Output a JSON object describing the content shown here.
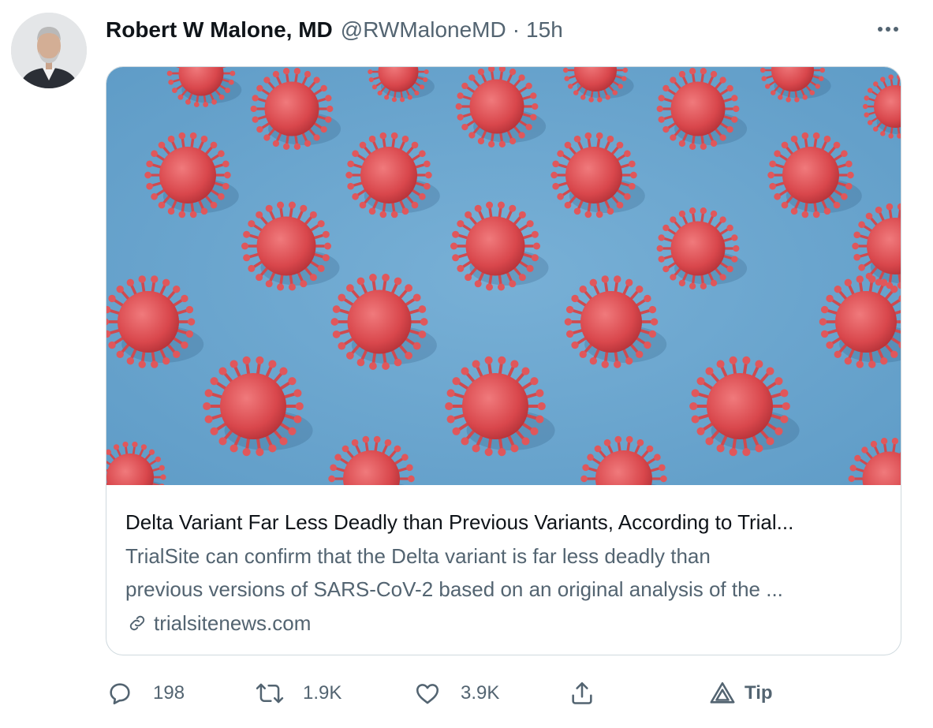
{
  "tweet": {
    "author_name": "Robert W Malone, MD",
    "handle": "@RWMaloneMD",
    "separator": "·",
    "time": "15h",
    "more_icon": "more-horizontal-icon"
  },
  "card": {
    "image_icon": "virus-pattern-image",
    "title": "Delta Variant Far Less Deadly than Previous Variants, According to Trial...",
    "description_lines": [
      "TrialSite can confirm that the Delta variant is far less deadly than",
      "previous versions of SARS-CoV-2 based on an original analysis of the ..."
    ],
    "domain": "trialsitenews.com",
    "link_icon": "link-icon"
  },
  "actions": {
    "reply": {
      "icon": "reply-icon",
      "count": "198"
    },
    "retweet": {
      "icon": "retweet-icon",
      "count": "1.9K"
    },
    "like": {
      "icon": "heart-icon",
      "count": "3.9K"
    },
    "share": {
      "icon": "share-icon"
    },
    "tip": {
      "icon": "tip-icon",
      "label": "Tip"
    }
  },
  "colors": {
    "text_primary": "#0f1419",
    "text_secondary": "#536471",
    "border": "#cfd9de",
    "image_background": "#6aa6cf",
    "virus_color": "#e0575b"
  }
}
